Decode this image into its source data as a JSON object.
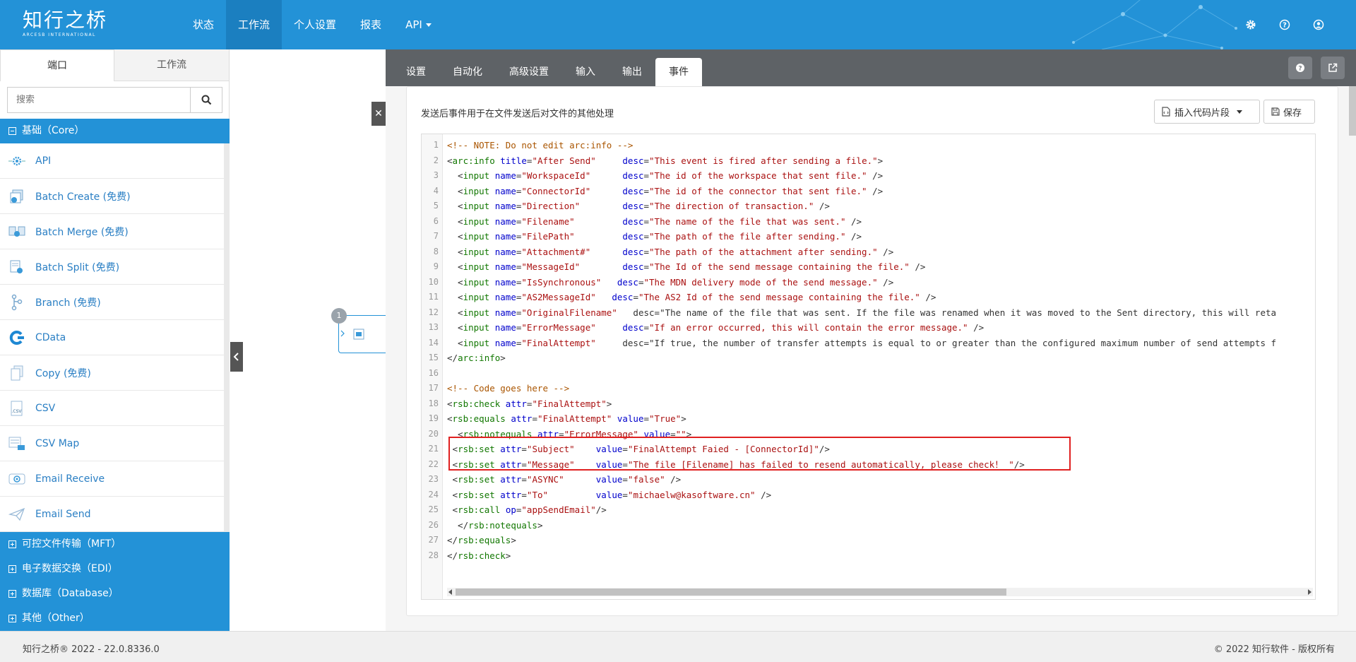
{
  "brand": {
    "name_cn": "知行之桥",
    "name_en": "ARCESB INTERNATIONAL"
  },
  "nav": {
    "items": [
      {
        "label": "状态"
      },
      {
        "label": "工作流"
      },
      {
        "label": "个人设置"
      },
      {
        "label": "报表"
      },
      {
        "label": "API"
      }
    ],
    "active": "工作流"
  },
  "top_icons": [
    "gear-icon",
    "help-icon",
    "user-icon"
  ],
  "sidebar": {
    "tabs": [
      {
        "label": "端口"
      },
      {
        "label": "工作流"
      }
    ],
    "search_placeholder": "搜索",
    "core_category": "基础（Core）",
    "items": [
      {
        "label": "API",
        "icon": "api-icon"
      },
      {
        "label": "Batch Create (免费)",
        "icon": "batch-create-icon"
      },
      {
        "label": "Batch Merge (免费)",
        "icon": "batch-merge-icon"
      },
      {
        "label": "Batch Split (免费)",
        "icon": "batch-split-icon"
      },
      {
        "label": "Branch (免费)",
        "icon": "branch-icon"
      },
      {
        "label": "CData",
        "icon": "cdata-icon"
      },
      {
        "label": "Copy (免费)",
        "icon": "copy-icon"
      },
      {
        "label": "CSV",
        "icon": "csv-icon"
      },
      {
        "label": "CSV Map",
        "icon": "csv-map-icon"
      },
      {
        "label": "Email Receive",
        "icon": "email-receive-icon"
      },
      {
        "label": "Email Send",
        "icon": "email-send-icon"
      }
    ],
    "other_categories": [
      {
        "label": "可控文件传输（MFT）"
      },
      {
        "label": "电子数据交换（EDI）"
      },
      {
        "label": "数据库（Database）"
      },
      {
        "label": "其他（Other）"
      }
    ]
  },
  "canvas": {
    "node_badge": "1"
  },
  "panel": {
    "tabs": [
      {
        "label": "设置"
      },
      {
        "label": "自动化"
      },
      {
        "label": "高级设置"
      },
      {
        "label": "输入"
      },
      {
        "label": "输出"
      },
      {
        "label": "事件"
      }
    ],
    "active_tab": "事件",
    "description": "发送后事件用于在文件发送后对文件的其他处理",
    "insert_snippet_label": "插入代码片段",
    "save_label": "保存"
  },
  "code_lines": [
    "<!-- NOTE: Do not edit arc:info -->",
    "<arc:info title=\"After Send\"     desc=\"This event is fired after sending a file.\">",
    "  <input name=\"WorkspaceId\"      desc=\"The id of the workspace that sent file.\" />",
    "  <input name=\"ConnectorId\"      desc=\"The id of the connector that sent file.\" />",
    "  <input name=\"Direction\"        desc=\"The direction of transaction.\" />",
    "  <input name=\"Filename\"         desc=\"The name of the file that was sent.\" />",
    "  <input name=\"FilePath\"         desc=\"The path of the file after sending.\" />",
    "  <input name=\"Attachment#\"      desc=\"The path of the attachment after sending.\" />",
    "  <input name=\"MessageId\"        desc=\"The Id of the send message containing the file.\" />",
    "  <input name=\"IsSynchronous\"   desc=\"The MDN delivery mode of the send message.\" />",
    "  <input name=\"AS2MessageId\"   desc=\"The AS2 Id of the send message containing the file.\" />",
    "  <input name=\"OriginalFilename\"   desc=\"The name of the file that was sent. If the file was renamed when it was moved to the Sent directory, this will reta",
    "  <input name=\"ErrorMessage\"     desc=\"If an error occurred, this will contain the error message.\" />",
    "  <input name=\"FinalAttempt\"     desc=\"If true, the number of transfer attempts is equal to or greater than the configured maximum number of send attempts f",
    "</arc:info>",
    "",
    "<!-- Code goes here -->",
    "<rsb:check attr=\"FinalAttempt\">",
    "<rsb:equals attr=\"FinalAttempt\" value=\"True\">",
    "  <rsb:notequals attr=\"ErrorMessage\" value=\"\">",
    " <rsb:set attr=\"Subject\"    value=\"FinalAttempt Faied - [ConnectorId]\"/>",
    " <rsb:set attr=\"Message\"    value=\"The file [Filename] has failed to resend automatically, please check！ \"/>",
    " <rsb:set attr=\"ASYNC\"      value=\"false\" />",
    " <rsb:set attr=\"To\"         value=\"michaelw@kasoftware.cn\" />",
    " <rsb:call op=\"appSendEmail\"/>",
    "  </rsb:notequals>",
    "</rsb:equals>",
    "</rsb:check>"
  ],
  "footer": {
    "left": "知行之桥® 2022 - 22.0.8336.0",
    "right": "© 2022 知行软件 - 版权所有"
  },
  "colors": {
    "brand": "#2392d7",
    "nav_active": "#1b7fc0",
    "tab_bar": "#5e6266",
    "highlight_box": "#e02020"
  }
}
